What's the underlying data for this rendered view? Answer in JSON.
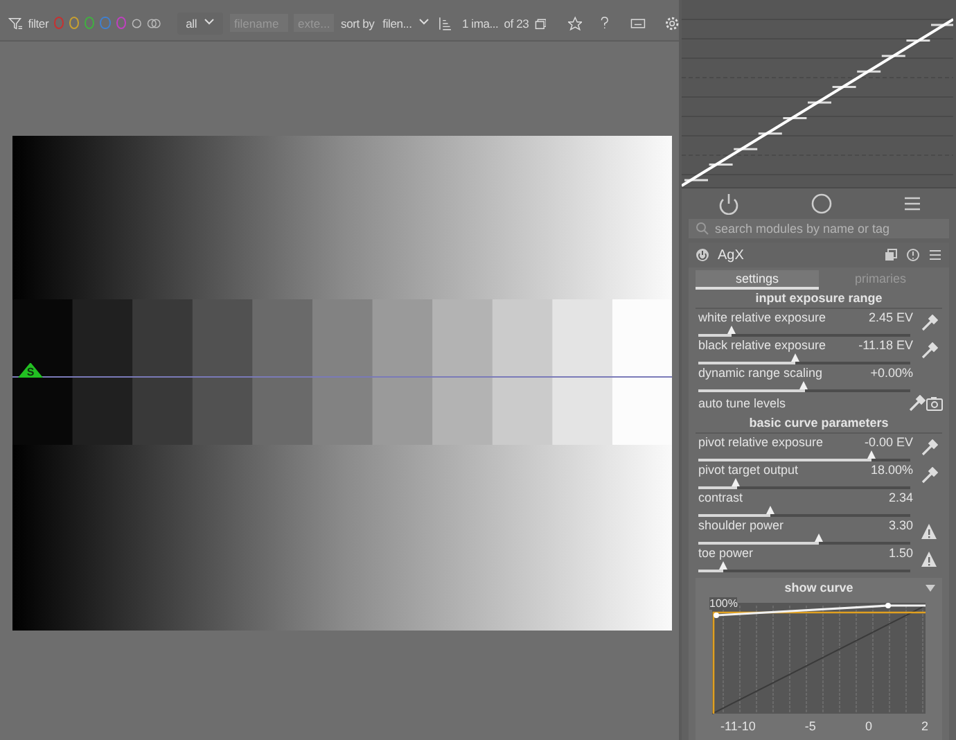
{
  "toolbar": {
    "filter_label": "filter",
    "color_labels": [
      {
        "color": "#c83030"
      },
      {
        "color": "#c8a030"
      },
      {
        "color": "#40b040"
      },
      {
        "color": "#4080d0"
      },
      {
        "color": "#c040c0"
      }
    ],
    "scope": "all",
    "filename_placeholder": "filename",
    "extension_placeholder": "exte...",
    "sort_label": "sort by",
    "sort_value": "filen...",
    "count": "1 ima...",
    "total": "of 23"
  },
  "preview": {
    "marker": "S"
  },
  "panel": {
    "search_placeholder": "search modules by name or tag",
    "module": {
      "name": "AgX",
      "tabs": [
        {
          "label": "settings",
          "selected": true
        },
        {
          "label": "primaries",
          "selected": false
        }
      ],
      "rows": [
        {
          "kind": "section",
          "label": "input exposure range"
        },
        {
          "kind": "slider",
          "label": "white relative exposure",
          "value": "2.45 EV",
          "level": 0.16,
          "picker": true,
          "warning": false
        },
        {
          "kind": "slider",
          "label": "black relative exposure",
          "value": "-11.18 EV",
          "level": 0.46,
          "picker": true,
          "warning": false
        },
        {
          "kind": "slider",
          "label": "dynamic range scaling",
          "value": "+0.00%",
          "level": 0.5,
          "picker": false,
          "warning": false
        },
        {
          "kind": "auto",
          "label": "auto tune levels"
        },
        {
          "kind": "section",
          "label": "basic curve parameters"
        },
        {
          "kind": "slider",
          "label": "pivot relative exposure",
          "value": "-0.00 EV",
          "level": 0.82,
          "picker": true,
          "warning": false
        },
        {
          "kind": "slider",
          "label": "pivot target output",
          "value": "18.00%",
          "level": 0.18,
          "picker": true,
          "warning": false
        },
        {
          "kind": "slider",
          "label": "contrast",
          "value": "2.34",
          "level": 0.34,
          "picker": false,
          "warning": false
        },
        {
          "kind": "slider",
          "label": "shoulder power",
          "value": "3.30",
          "level": 0.57,
          "picker": false,
          "warning": true
        },
        {
          "kind": "slider",
          "label": "toe power",
          "value": "1.50",
          "level": 0.12,
          "picker": false,
          "warning": true
        }
      ]
    },
    "curve": {
      "title": "show curve",
      "y_label": "100%",
      "x_labels": [
        "-11-10",
        "-5",
        "0",
        "2"
      ]
    }
  }
}
